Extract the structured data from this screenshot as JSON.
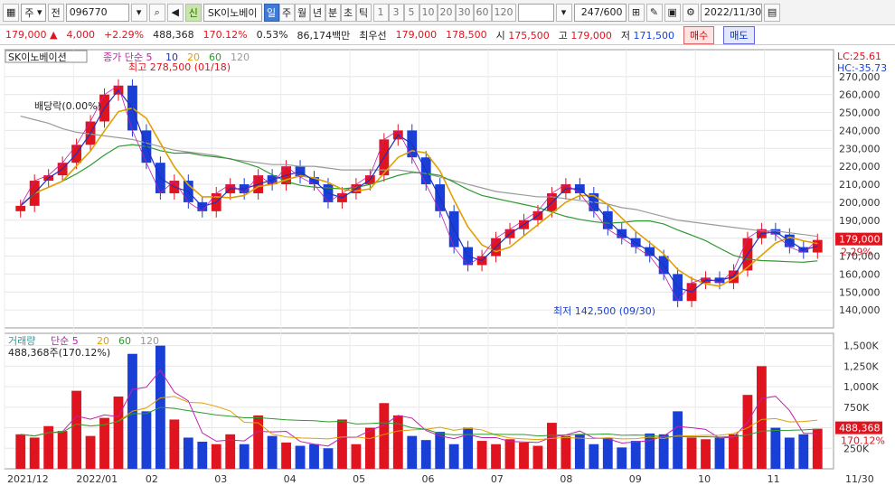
{
  "toolbar": {
    "market": "주",
    "market_mode": "전",
    "code": "096770",
    "name": "SK이노베이",
    "credit_badge": "신",
    "periods": [
      "일",
      "주",
      "월",
      "년",
      "분",
      "초",
      "틱"
    ],
    "active_period": "일",
    "intervals": [
      "1",
      "3",
      "5",
      "10",
      "20",
      "30",
      "60",
      "120"
    ],
    "count": "247/600",
    "date": "2022/11/30"
  },
  "quote": {
    "price": "179,000",
    "change_arrow": "▲",
    "change": "4,000",
    "change_rate": "+2.29%",
    "volume": "488,368",
    "volume_ratio": "170.12%",
    "turnover_rate": "0.53%",
    "amount": "86,174백만",
    "best_label": "최우선",
    "best_ask": "179,000",
    "best_bid": "178,500",
    "open_label": "시",
    "open": "175,500",
    "high_label": "고",
    "high": "179,000",
    "low_label": "저",
    "low": "171,500",
    "sell_label": "매수",
    "buy_label": "매도"
  },
  "price_panel": {
    "legend_name": "SK이노베이션",
    "legend_prefix": "종가 단순",
    "ma_periods": [
      "5",
      "10",
      "20",
      "60",
      "120"
    ],
    "lc": "LC:25.61",
    "hc": "HC:-35.73",
    "high_marker": "최고 278,500 (01/18)",
    "low_marker": "최저 142,500 (09/30)",
    "dividend_marker": "배당락(0.00%)",
    "last_price_tag": "179,000",
    "last_rate_tag": "2.29%"
  },
  "volume_panel": {
    "legend_label": "거래량",
    "legend_prefix": "단순",
    "ma_periods": [
      "5",
      "20",
      "60",
      "120"
    ],
    "current": "488,368주(170.12%)",
    "last_volume_tag": "488,368",
    "last_rate_tag": "170.12%"
  },
  "x_axis": [
    "2021/12",
    "2022/01",
    "02",
    "03",
    "04",
    "05",
    "06",
    "07",
    "08",
    "09",
    "10",
    "11",
    "11/30"
  ],
  "colors": {
    "up": "#e0141e",
    "down": "#1a3fd6",
    "ma5": "#c21fb0",
    "ma10": "#1f2fc2",
    "ma20": "#e0a000",
    "ma60": "#2f9a2f",
    "ma120": "#9a9a9a"
  },
  "chart_data": [
    {
      "type": "line",
      "title": "SK이노베이션",
      "ylabel": "",
      "ylim": [
        130000,
        285000
      ],
      "y_ticks": [
        140000,
        150000,
        160000,
        170000,
        180000,
        190000,
        200000,
        210000,
        220000,
        230000,
        240000,
        250000,
        260000,
        270000
      ],
      "x_labels": [
        "2021/12",
        "2022/01",
        "02",
        "03",
        "04",
        "05",
        "06",
        "07",
        "08",
        "09",
        "10",
        "11",
        "11/30"
      ],
      "series": [
        {
          "name": "종가",
          "values": [
            198000,
            212000,
            215000,
            222000,
            232000,
            245000,
            260000,
            265000,
            240000,
            222000,
            205000,
            212000,
            200000,
            195000,
            205000,
            210000,
            205000,
            215000,
            210000,
            220000,
            214000,
            210000,
            200000,
            205000,
            210000,
            215000,
            235000,
            240000,
            225000,
            210000,
            195000,
            175000,
            165000,
            170000,
            180000,
            185000,
            190000,
            195000,
            205000,
            210000,
            205000,
            195000,
            185000,
            180000,
            175000,
            170000,
            160000,
            145000,
            155000,
            158000,
            155000,
            162000,
            180000,
            185000,
            182000,
            175000,
            172000,
            179000
          ]
        },
        {
          "name": "120",
          "values": [
            248000,
            246000,
            244000,
            241000,
            239000,
            238000,
            237000,
            236000,
            235000,
            233000,
            231000,
            229000,
            228000,
            227000,
            226000,
            224000,
            223000,
            222000,
            221000,
            221000,
            220000,
            220000,
            219000,
            218000,
            218000,
            218000,
            218000,
            218000,
            217000,
            216000,
            214000,
            212000,
            210000,
            208000,
            206000,
            205000,
            204000,
            203000,
            203000,
            202000,
            201000,
            200000,
            199000,
            197000,
            196000,
            194000,
            192000,
            190000,
            189000,
            188000,
            187000,
            186000,
            185000,
            184000,
            184000,
            183000,
            182000,
            181000
          ]
        }
      ]
    },
    {
      "type": "bar",
      "title": "거래량",
      "ylim": [
        0,
        1650000
      ],
      "y_ticks": [
        250000,
        500000,
        750000,
        1000000,
        1250000,
        1500000
      ],
      "y_tick_labels": [
        "250K",
        "500K",
        "750K",
        "1,000K",
        "1,250K",
        "1,500K"
      ],
      "series": [
        {
          "name": "거래량",
          "values": [
            420000,
            380000,
            520000,
            460000,
            950000,
            400000,
            620000,
            880000,
            1400000,
            700000,
            1500000,
            600000,
            380000,
            330000,
            300000,
            420000,
            300000,
            650000,
            400000,
            320000,
            280000,
            300000,
            250000,
            600000,
            300000,
            500000,
            800000,
            650000,
            400000,
            350000,
            450000,
            300000,
            500000,
            340000,
            300000,
            360000,
            320000,
            280000,
            560000,
            400000,
            420000,
            300000,
            380000,
            260000,
            340000,
            430000,
            420000,
            700000,
            380000,
            360000,
            380000,
            420000,
            900000,
            1250000,
            500000,
            380000,
            420000,
            488368
          ]
        }
      ]
    }
  ]
}
